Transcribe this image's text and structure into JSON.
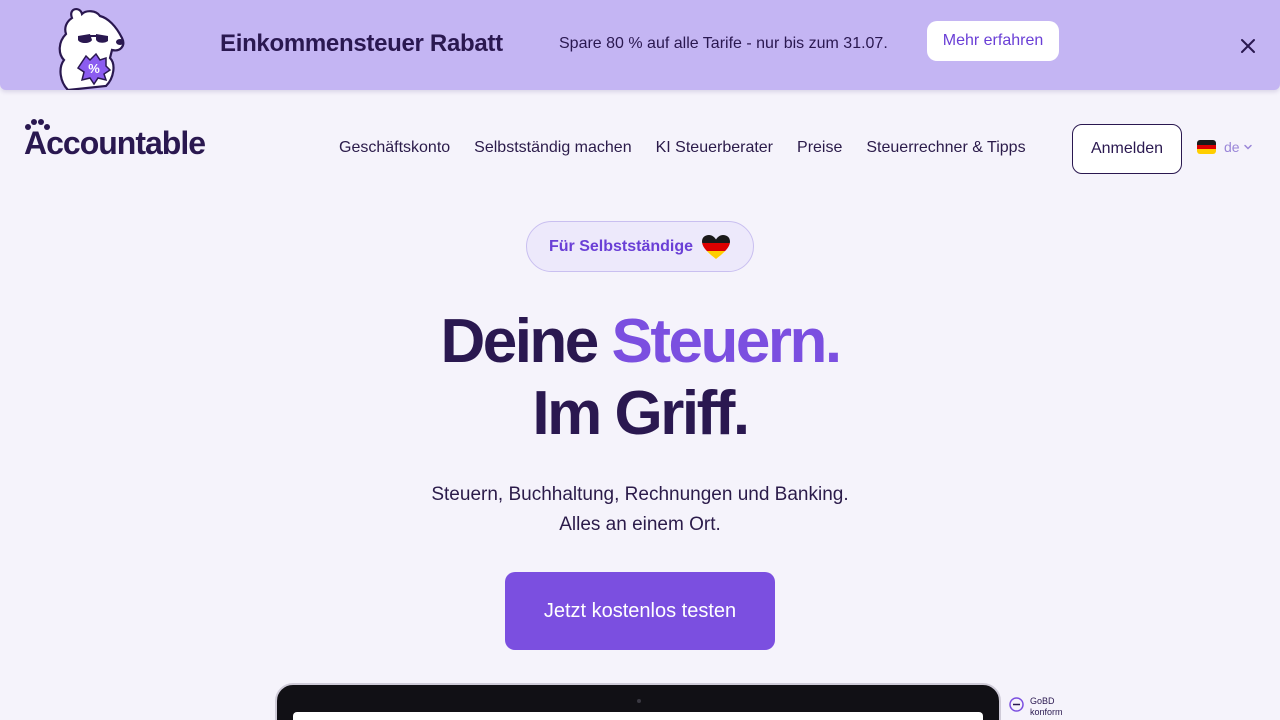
{
  "banner": {
    "title": "Einkommensteuer Rabatt",
    "text": "Spare 80 % auf alle Tarife - nur bis zum 31.07.",
    "cta_label": "Mehr erfahren",
    "mascot_badge": "%",
    "mascot_icon": "dog-mascot-icon",
    "close_icon": "close-icon"
  },
  "header": {
    "logo_text": "Accountable",
    "nav": [
      {
        "label": "Geschäftskonto"
      },
      {
        "label": "Selbstständig machen"
      },
      {
        "label": "KI Steuerberater"
      },
      {
        "label": "Preise"
      },
      {
        "label": "Steuerrechner & Tipps"
      }
    ],
    "login_label": "Anmelden",
    "language": "de"
  },
  "hero": {
    "pill_label": "Für Selbstständige",
    "headline_part1": "Deine ",
    "headline_accent": "Steuern.",
    "headline_line2": "Im Griff.",
    "subline1": "Steuern, Buchhaltung, Rechnungen und Banking.",
    "subline2": "Alles an einem Ort.",
    "cta_label": "Jetzt kostenlos testen"
  },
  "badge": {
    "line1": "GoBD",
    "line2": "konform"
  },
  "colors": {
    "banner_bg": "#c4b5f3",
    "page_bg": "#f5f3fb",
    "accent": "#7b4fe0",
    "dark": "#2a1850"
  }
}
